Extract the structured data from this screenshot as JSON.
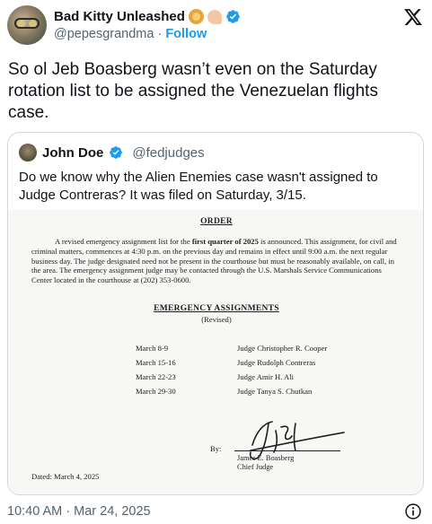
{
  "author": {
    "display_name": "Bad Kitty Unleashed",
    "emojis": [
      "lion-emoji",
      "flexed-biceps-emoji"
    ],
    "handle": "@pepesgrandma",
    "separator": "·",
    "follow_label": "Follow"
  },
  "tweet": {
    "text": "So ol Jeb Boasberg wasn’t even on the Saturday rotation list to be assigned the Venezuelan flights case.",
    "timestamp": "10:40 AM · Mar 24, 2025"
  },
  "quoted": {
    "display_name": "John Doe",
    "handle": "@fedjudges",
    "text": "Do we know why the Alien Enemies case wasn't assigned to Judge Contreras? It was filed on Saturday, 3/15."
  },
  "document": {
    "title": "ORDER",
    "para_before": "A revised emergency assignment list for the ",
    "para_bold": "first quarter of 2025",
    "para_after": " is announced.  This assignment, for civil and criminal matters, commences at 4:30 p.m. on the previous day and remains in effect until 9:00 a.m. the next regular business day.  The judge designated need not be present in the courthouse but must be reasonably available, on call, in the area.  The emergency assignment judge may be contacted through the U.S. Marshals Service Communications Center located in the courthouse at (202) 353-0600.",
    "assignments_title": "EMERGENCY ASSIGNMENTS",
    "assignments_subtitle": "(Revised)",
    "schedule": [
      {
        "dates": "March 8-9",
        "judge": "Judge Christopher R. Cooper"
      },
      {
        "dates": "March 15-16",
        "judge": "Judge Rudolph Contreras"
      },
      {
        "dates": "March 22-23",
        "judge": "Judge Amir H. Ali"
      },
      {
        "dates": "March 29-30",
        "judge": "Judge Tanya S. Chutkan"
      }
    ],
    "by_label": "By:",
    "signer_name": "James E. Boasberg",
    "signer_title": "Chief Judge",
    "dated": "Dated: March 4, 2025"
  },
  "colors": {
    "link": "#1d9bf0",
    "verified": "#1d9bf0",
    "secondary_text": "#536471",
    "border": "#cfd9de"
  }
}
